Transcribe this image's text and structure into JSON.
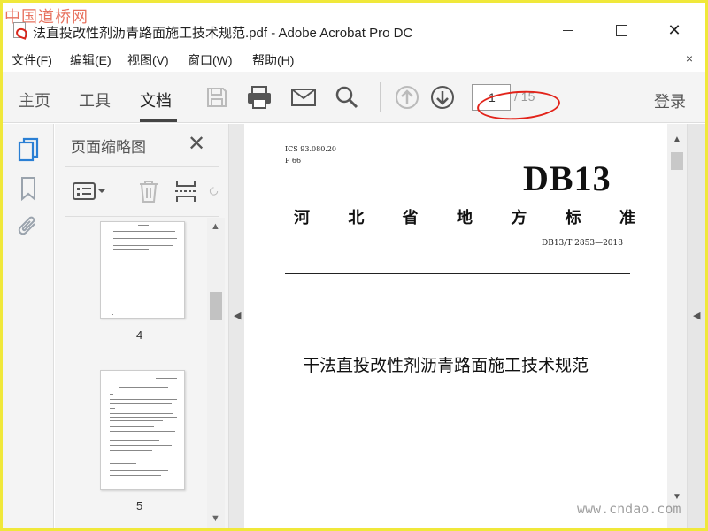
{
  "watermarks": {
    "top_left": "中国道桥网",
    "bottom_right": "www.cndao.com"
  },
  "window": {
    "title": "法直投改性剂沥青路面施工技术规范.pdf - Adobe Acrobat Pro DC",
    "controls": {
      "minimize_icon": "minimize-icon",
      "maximize_icon": "maximize-icon",
      "close_icon": "close-icon",
      "close_glyph": "✕"
    }
  },
  "menubar": {
    "items": [
      "文件(F)",
      "编辑(E)",
      "视图(V)",
      "窗口(W)",
      "帮助(H)"
    ],
    "close_glyph": "×"
  },
  "toolbar": {
    "tabs": [
      "主页",
      "工具",
      "文档"
    ],
    "active_tab": "文档",
    "icons": [
      "save-icon",
      "print-icon",
      "email-icon",
      "search-icon",
      "page-up-icon",
      "page-down-icon"
    ],
    "page_current": "1",
    "page_total": "/ 15",
    "login": "登录",
    "annotation_color": "#e2231a"
  },
  "navrail": {
    "icons": [
      "page-thumbnails-icon",
      "bookmark-icon",
      "attachment-icon"
    ],
    "active_color": "#2a7fd4"
  },
  "thumbnail_panel": {
    "title": "页面缩略图",
    "close_glyph": "✕",
    "tools": [
      "thumbnail-options-icon",
      "delete-page-icon",
      "insert-page-icon",
      "rotate-page-icon"
    ],
    "pages": [
      {
        "label": "4"
      },
      {
        "label": "5"
      }
    ]
  },
  "document": {
    "ics": "ICS 93.080.20",
    "p_code": "P 66",
    "standard_prefix": "DB13",
    "province": [
      "河",
      "北",
      "省",
      "地",
      "方",
      "标",
      "准"
    ],
    "standard_code": "DB13/T 2853—2018",
    "heading": "干法直投改性剂沥青路面施工技术规范"
  }
}
